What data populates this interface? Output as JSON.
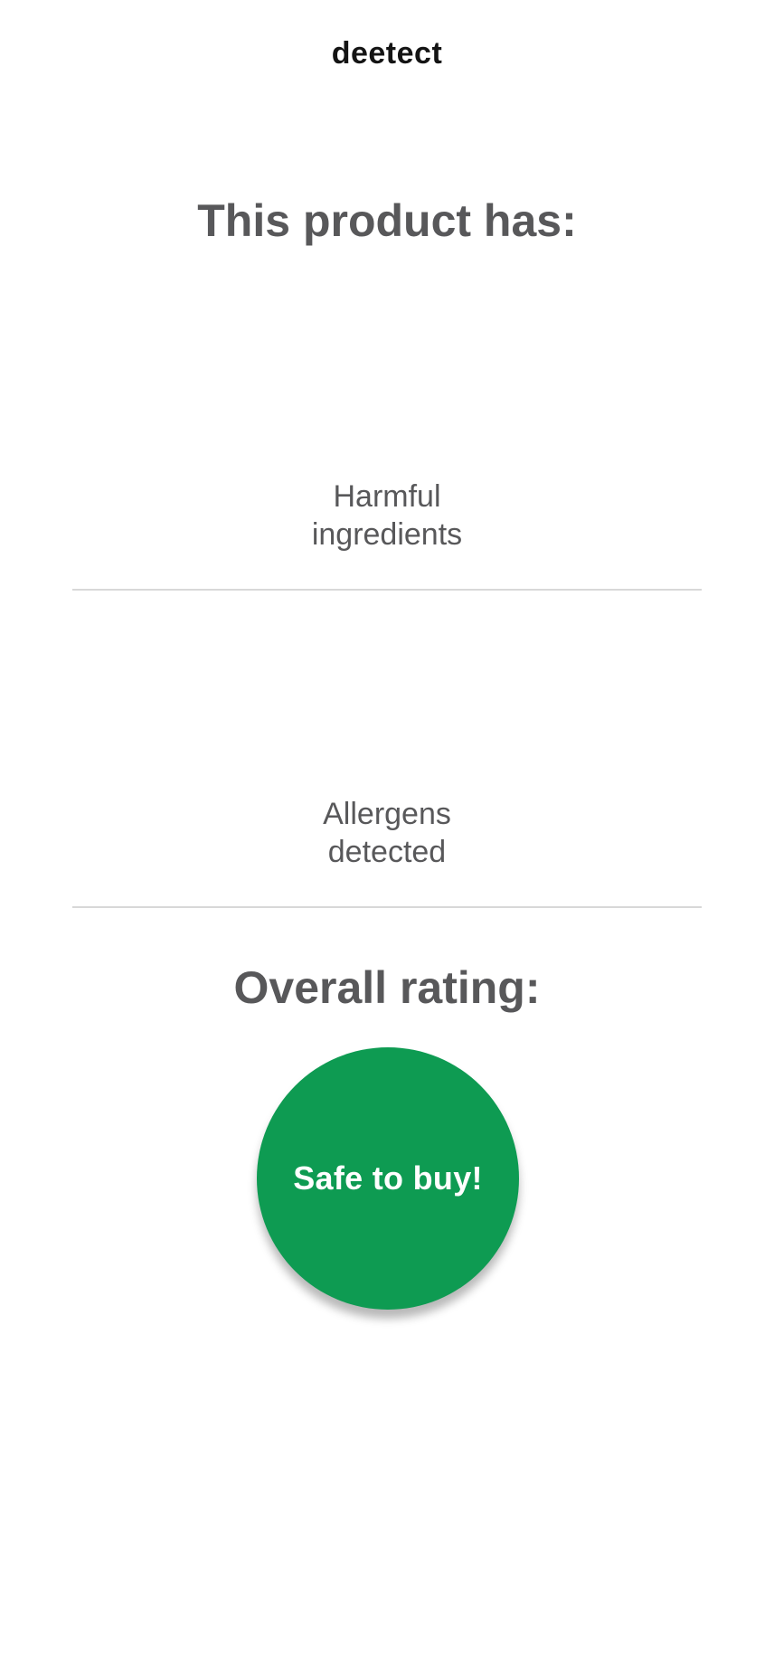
{
  "app": {
    "title": "deetect"
  },
  "product": {
    "heading": "This product has:",
    "metrics": [
      {
        "label_line1": "Harmful",
        "label_line2": "ingredients"
      },
      {
        "label_line1": "Allergens",
        "label_line2": "detected"
      }
    ]
  },
  "rating": {
    "heading": "Overall rating:",
    "verdict": "Safe to buy!",
    "color": "#0e9b52"
  }
}
